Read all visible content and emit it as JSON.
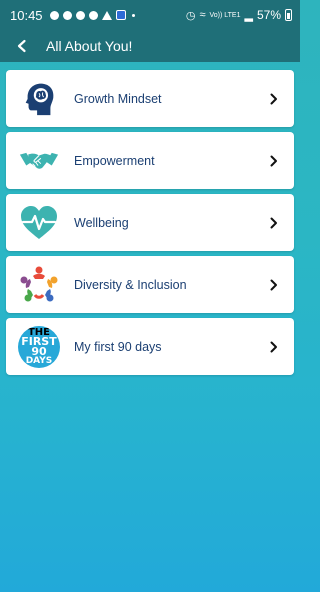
{
  "status": {
    "time": "10:45",
    "signal": "Vo)) LTE1",
    "battery": "57%"
  },
  "header": {
    "title": "All About You!"
  },
  "items": [
    {
      "label": "Growth Mindset",
      "icon": "head-brain-icon"
    },
    {
      "label": "Empowerment",
      "icon": "handshake-icon"
    },
    {
      "label": "Wellbeing",
      "icon": "heart-pulse-icon"
    },
    {
      "label": "Diversity & Inclusion",
      "icon": "people-circle-icon"
    },
    {
      "label": "My first 90 days",
      "icon": "first-90-days-logo"
    }
  ],
  "logo_text": {
    "the": "THE",
    "first": "FIRST",
    "ninety": "90",
    "days": "DAYS"
  },
  "colors": {
    "appbar": "#1f6f78",
    "icon_dark": "#1b3f72",
    "icon_teal": "#3db3b0",
    "background_top": "#2eb4bd",
    "background_bottom": "#22a9d9"
  }
}
